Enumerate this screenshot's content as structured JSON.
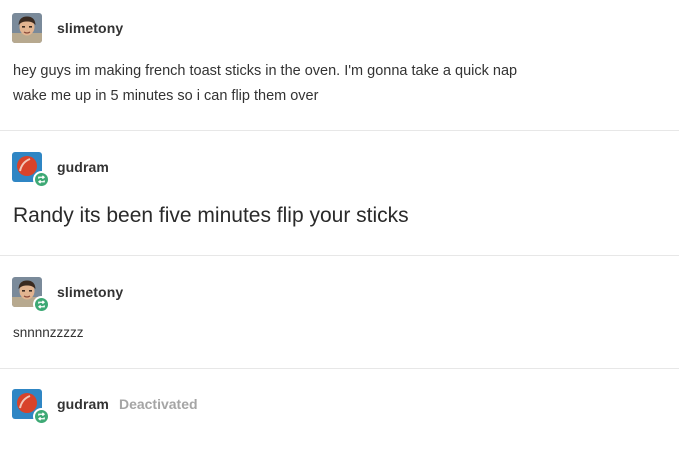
{
  "posts": [
    {
      "username": "slimetony",
      "avatar": "person-avatar",
      "reblog_badge": false,
      "lines": [
        "hey guys im making french toast sticks in the oven. I'm gonna take a quick nap",
        "wake me up in 5 minutes so i can flip them over"
      ]
    },
    {
      "username": "gudram",
      "avatar": "red-circle-avatar",
      "reblog_badge": true,
      "text": "Randy its been five minutes flip your sticks"
    },
    {
      "username": "slimetony",
      "avatar": "person-avatar",
      "reblog_badge": true,
      "text": "snnnnzzzzz"
    },
    {
      "username": "gudram",
      "avatar": "red-circle-avatar",
      "reblog_badge": true,
      "status": "Deactivated"
    }
  ],
  "colors": {
    "reblog_green": "#3ea975",
    "divider": "#e7e7e7",
    "deactivated_gray": "#a5a5a5",
    "gudram_avatar_bg": "#2f86c4",
    "gudram_avatar_circle": "#d8432a"
  }
}
